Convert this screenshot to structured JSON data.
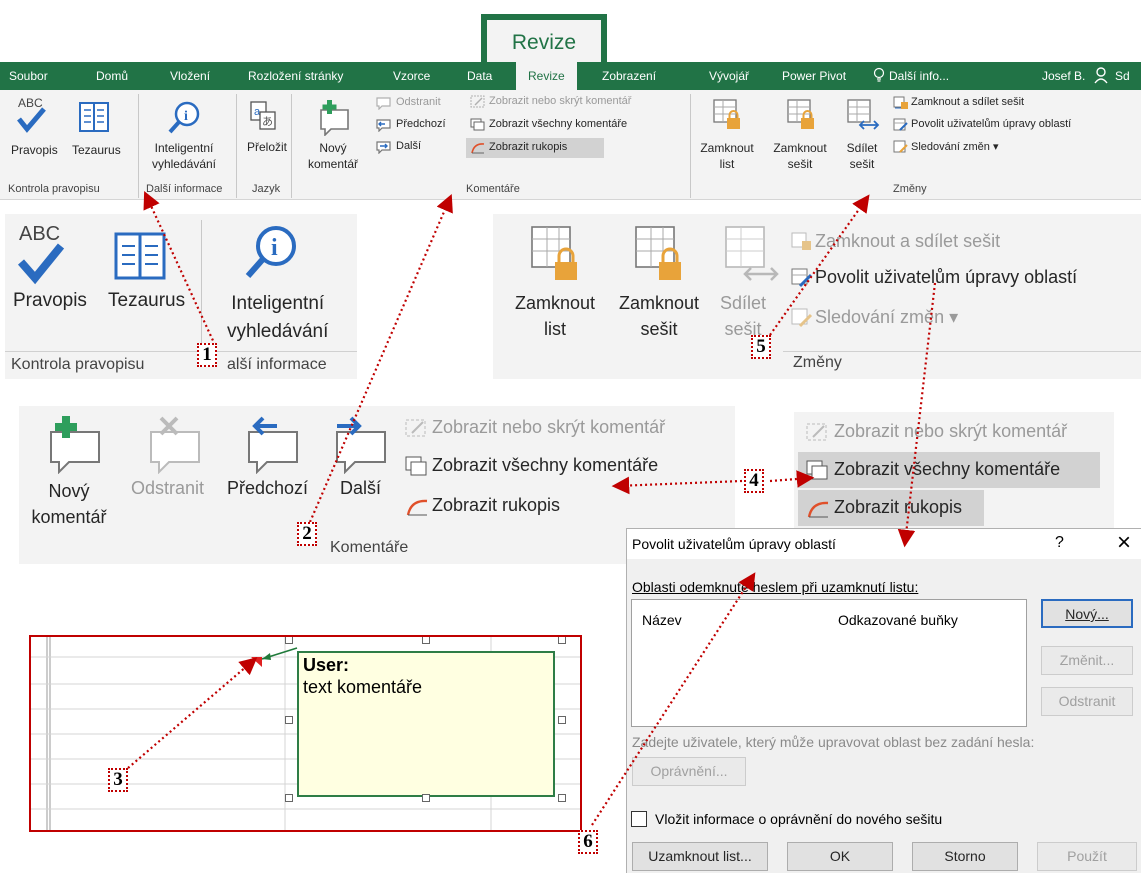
{
  "ribbon_badge": "Revize",
  "tabs": [
    "Soubor",
    "Domů",
    "Vložení",
    "Rozložení stránky",
    "Vzorce",
    "Data",
    "Revize",
    "Zobrazení",
    "Vývojář",
    "Power Pivot",
    "Další info...",
    "Josef B.",
    "Sd"
  ],
  "ribbon": {
    "proofing": {
      "spelling": "Pravopis",
      "thesaurus": "Tezaurus",
      "group": "Kontrola pravopisu"
    },
    "insights": {
      "smart_lookup_1": "Inteligentní",
      "smart_lookup_2": "vyhledávání",
      "group": "Další informace"
    },
    "language": {
      "translate": "Přeložit",
      "group": "Jazyk"
    },
    "comments": {
      "new_1": "Nový",
      "new_2": "komentář",
      "delete": "Odstranit",
      "previous": "Předchozí",
      "next": "Další",
      "show_hide": "Zobrazit nebo skrýt komentář",
      "show_all": "Zobrazit všechny komentáře",
      "show_ink": "Zobrazit rukopis",
      "group": "Komentáře"
    },
    "changes": {
      "protect_sheet_1": "Zamknout",
      "protect_sheet_2": "list",
      "protect_wb_1": "Zamknout",
      "protect_wb_2": "sešit",
      "share_1": "Sdílet",
      "share_2": "sešit",
      "protect_share": "Zamknout a sdílet sešit",
      "allow_edit": "Povolit uživatelům úpravy oblastí",
      "track": "Sledování změn",
      "group": "Změny"
    }
  },
  "zoom1": {
    "spelling": "Pravopis",
    "thesaurus": "Tezaurus",
    "smart_1": "Inteligentní",
    "smart_2": "vyhledávání",
    "group_a": "Kontrola pravopisu",
    "group_b": "alší informace"
  },
  "zoom2": {
    "new_1": "Nový",
    "new_2": "komentář",
    "delete": "Odstranit",
    "previous": "Předchozí",
    "next": "Další",
    "show_hide": "Zobrazit nebo skrýt komentář",
    "show_all": "Zobrazit všechny komentáře",
    "show_ink": "Zobrazit rukopis",
    "group": "Komentáře"
  },
  "zoom4": {
    "show_hide": "Zobrazit nebo skrýt komentář",
    "show_all": "Zobrazit všechny komentáře",
    "show_ink": "Zobrazit rukopis"
  },
  "zoom5": {
    "protect_sheet_1": "Zamknout",
    "protect_sheet_2": "list",
    "protect_wb_1": "Zamknout",
    "protect_wb_2": "sešit",
    "share_1": "Sdílet",
    "share_2": "sešit",
    "protect_share": "Zamknout a sdílet sešit",
    "allow_edit": "Povolit uživatelům úpravy oblastí",
    "track": "Sledování změn",
    "group": "Změny"
  },
  "callouts": [
    "1",
    "2",
    "3",
    "4",
    "5",
    "6"
  ],
  "comment": {
    "author": "User:",
    "text": "text komentáře"
  },
  "dialog": {
    "title": "Povolit uživatelům úpravy oblastí",
    "help": "?",
    "close": "×",
    "ranges_label": "Oblasti odemknuté heslem při uzamknutí listu:",
    "col_name": "Název",
    "col_refers": "Odkazované buňky",
    "btn_new": "Nový...",
    "btn_modify": "Změnit...",
    "btn_delete": "Odstranit",
    "users_label": "Zadejte uživatele, který může upravovat oblast bez zadání hesla:",
    "btn_permissions": "Oprávnění...",
    "checkbox_label": "Vložit informace o oprávnění do nového sešitu",
    "btn_protect": "Uzamknout list...",
    "btn_ok": "OK",
    "btn_cancel": "Storno",
    "btn_apply": "Použít"
  },
  "colors": {
    "excel_green": "#217346",
    "callout_red": "#c00000",
    "comment_bg": "#ffffe1",
    "spell_check_blue": "#2a6bc0"
  }
}
